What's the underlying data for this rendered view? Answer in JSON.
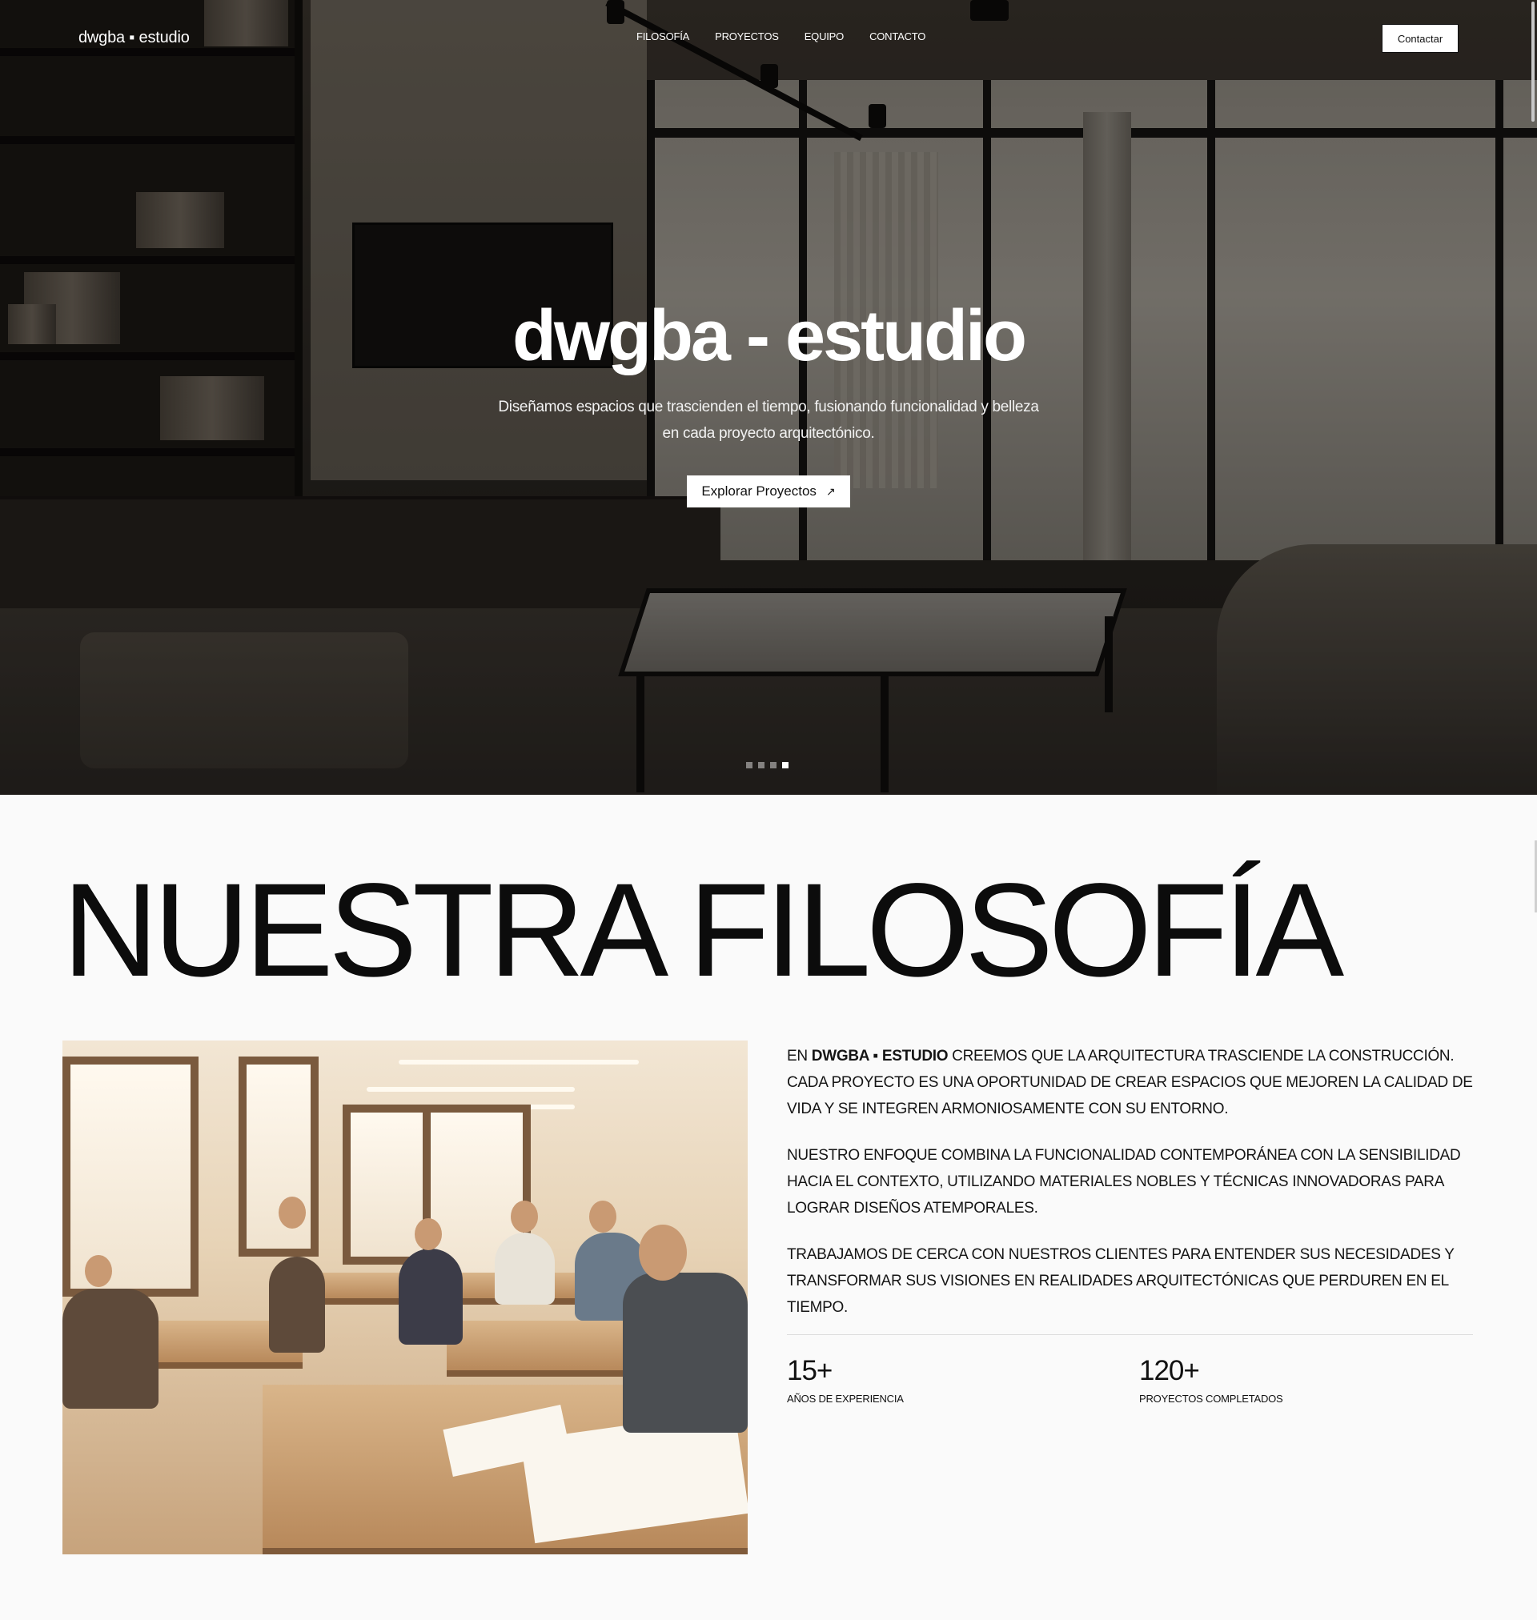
{
  "brand": {
    "logo_text": "dwgba ▪ estudio"
  },
  "nav": {
    "links": [
      "FILOSOFÍA",
      "PROYECTOS",
      "EQUIPO",
      "CONTACTO"
    ],
    "cta_label": "Contactar"
  },
  "hero": {
    "title": "dwgba - estudio",
    "subtitle": "Diseñamos espacios que trascienden el tiempo, fusionando funcionalidad y belleza en cada proyecto arquitectónico.",
    "button_label": "Explorar Proyectos",
    "button_icon": "arrow-up-right-icon",
    "slides_total": 4,
    "slide_active": 4
  },
  "philosophy": {
    "title": "NUESTRA FILOSOFÍA",
    "p1_prefix": "EN ",
    "p1_strong": "DWGBA ▪ ESTUDIO",
    "p1_rest": " CREEMOS QUE LA ARQUITECTURA TRASCIENDE LA CONSTRUCCIÓN. CADA PROYECTO ES UNA OPORTUNIDAD DE CREAR ESPACIOS QUE MEJOREN LA CALIDAD DE VIDA Y SE INTEGREN ARMONIOSAMENTE CON SU ENTORNO.",
    "p2": "NUESTRO ENFOQUE COMBINA LA FUNCIONALIDAD CONTEMPORÁNEA CON LA SENSIBILIDAD HACIA EL CONTEXTO, UTILIZANDO MATERIALES NOBLES Y TÉCNICAS INNOVADORAS PARA LOGRAR DISEÑOS ATEMPORALES.",
    "p3": "TRABAJAMOS DE CERCA CON NUESTROS CLIENTES PARA ENTENDER SUS NECESIDADES Y TRANSFORMAR SUS VISIONES EN REALIDADES ARQUITECTÓNICAS QUE PERDUREN EN EL TIEMPO.",
    "stats": [
      {
        "value": "15+",
        "label": "AÑOS DE EXPERIENCIA"
      },
      {
        "value": "120+",
        "label": "PROYECTOS COMPLETADOS"
      }
    ]
  }
}
